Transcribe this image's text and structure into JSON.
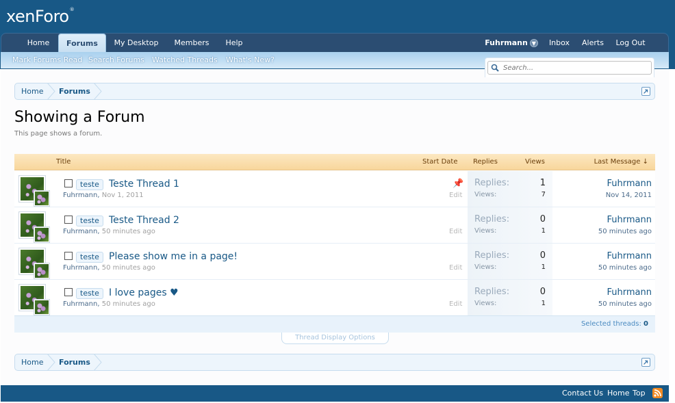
{
  "header": {
    "logo": "xenForo",
    "logo_tm": "®"
  },
  "nav": {
    "tabs": [
      "Home",
      "Forums",
      "My Desktop",
      "Members",
      "Help"
    ],
    "selected": "Forums",
    "user": "Fuhrmann",
    "inbox": "Inbox",
    "alerts": "Alerts",
    "logout": "Log Out"
  },
  "subnav": [
    "Mark Forums Read",
    "Search Forums",
    "Watched Threads",
    "What's New?"
  ],
  "search": {
    "placeholder": "Search..."
  },
  "breadcrumb": {
    "home": "Home",
    "forums": "Forums"
  },
  "page": {
    "title": "Showing a Forum",
    "description": "This page shows a forum."
  },
  "thread_list": {
    "headers": {
      "title": "Title",
      "start_date": "Start Date",
      "replies": "Replies",
      "views": "Views",
      "last_message": "Last Message ↓"
    },
    "replies_label": "Replies:",
    "views_label": "Views:",
    "edit_label": "Edit",
    "threads": [
      {
        "prefix": "teste",
        "title": "Teste Thread 1",
        "author": "Fuhrmann",
        "date": "Nov 1, 2011",
        "sticky": true,
        "replies": "1",
        "views": "7",
        "last_user": "Fuhrmann",
        "last_date": "Nov 14, 2011"
      },
      {
        "prefix": "teste",
        "title": "Teste Thread 2",
        "author": "Fuhrmann",
        "date": "50 minutes ago",
        "sticky": false,
        "replies": "0",
        "views": "1",
        "last_user": "Fuhrmann",
        "last_date": "50 minutes ago"
      },
      {
        "prefix": "teste",
        "title": "Please show me in a page!",
        "author": "Fuhrmann",
        "date": "50 minutes ago",
        "sticky": false,
        "replies": "0",
        "views": "1",
        "last_user": "Fuhrmann",
        "last_date": "50 minutes ago"
      },
      {
        "prefix": "teste",
        "title": "I love pages ♥",
        "author": "Fuhrmann",
        "date": "50 minutes ago",
        "sticky": false,
        "replies": "0",
        "views": "1",
        "last_user": "Fuhrmann",
        "last_date": "50 minutes ago"
      }
    ],
    "selected_label": "Selected threads:",
    "selected_count": "0",
    "display_options": "Thread Display Options"
  },
  "footer": {
    "contact": "Contact Us",
    "home": "Home",
    "top": "Top"
  },
  "colors": {
    "header_bg": "#185886",
    "link": "#185886",
    "table_header": "#fbe3b6"
  }
}
